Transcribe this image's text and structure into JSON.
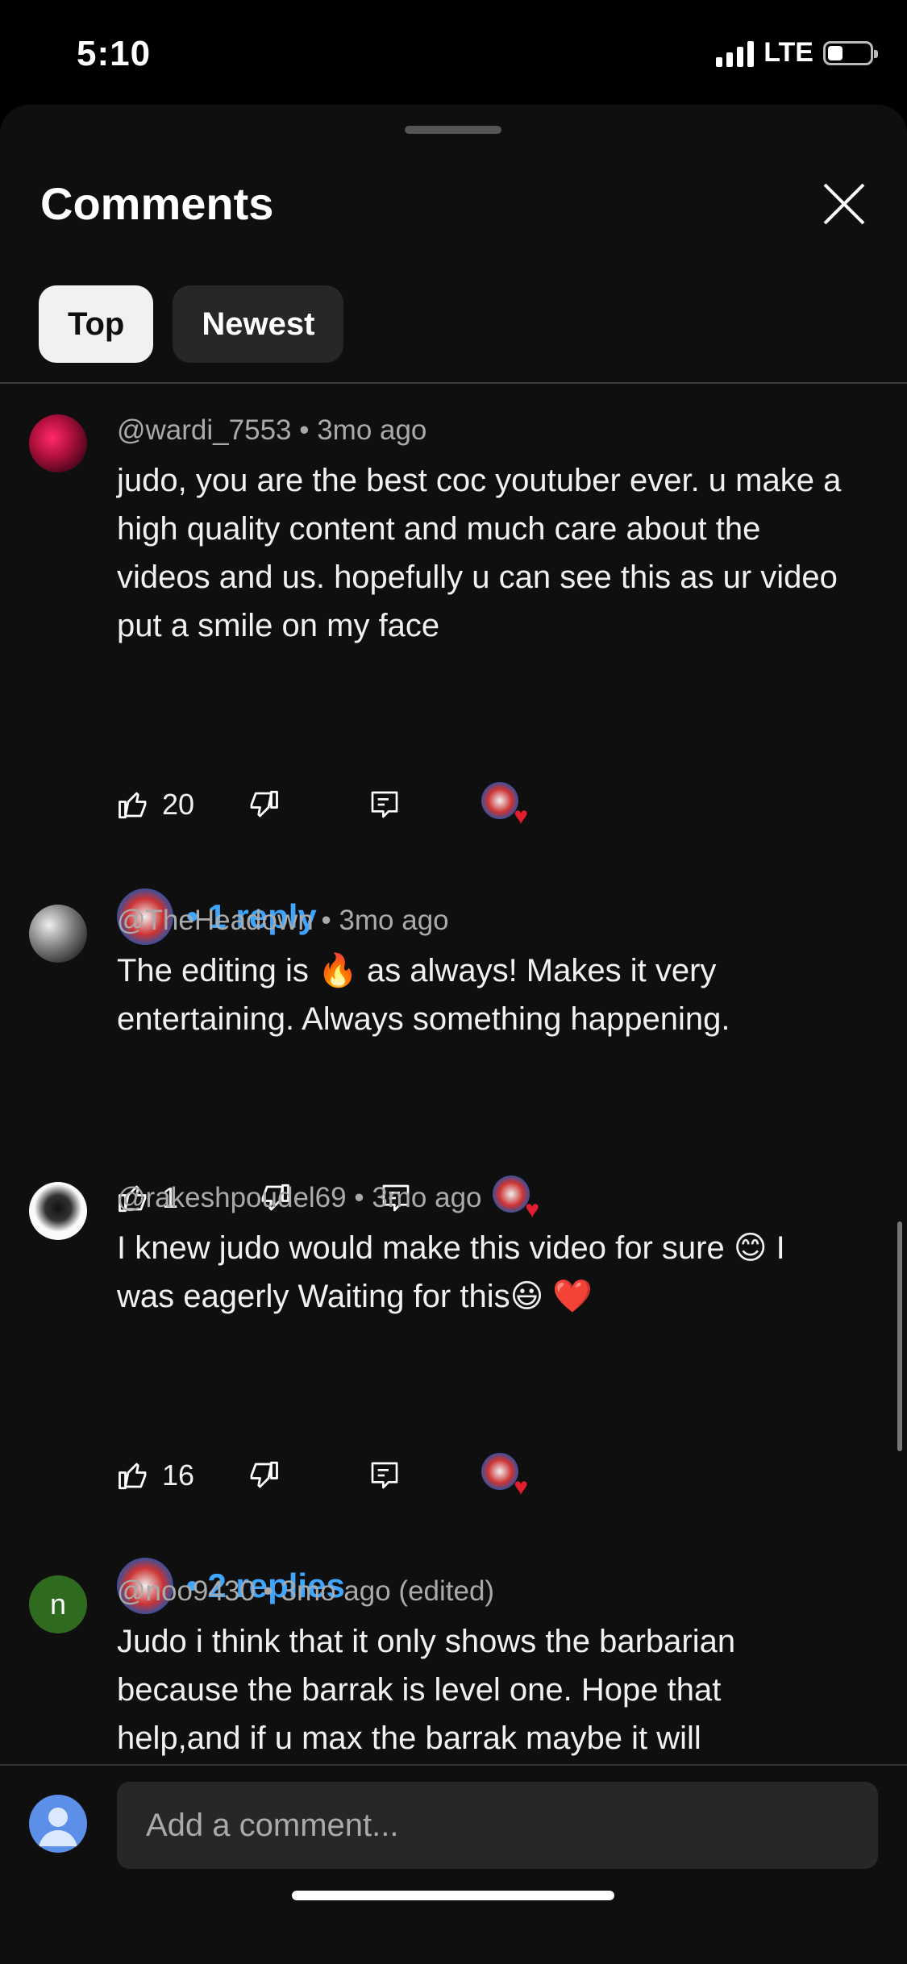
{
  "status": {
    "time": "5:10",
    "network": "LTE"
  },
  "sheet": {
    "title": "Comments",
    "tabs": [
      {
        "label": "Top",
        "active": true
      },
      {
        "label": "Newest",
        "active": false
      }
    ]
  },
  "comments": [
    {
      "meta": "@wardi_7553 • 3mo ago",
      "text": "judo, you are the best coc youtuber ever. u make a high quality content and much care about the videos and us. hopefully u can see this as ur video put a smile on my face",
      "likes": "20",
      "replies_label": "• 1 reply"
    },
    {
      "meta": "@TheHeadown • 3mo ago",
      "text": "The editing is 🔥 as always! Makes it very entertaining. Always something happening.",
      "likes": "1"
    },
    {
      "meta": "@rakeshpoudel69 • 3mo ago",
      "text": "I knew judo would make this video for sure 😊 I was eagerly Waiting for this😃 ❤️",
      "likes": "16",
      "replies_label": "• 2 replies"
    },
    {
      "meta": "@noo9430 • 3mo ago (edited)",
      "avatar_letter": "n",
      "text": "Judo i think that it only shows the barbarian because the barrak is level one. Hope that help,and if u max the barrak maybe it will"
    }
  ],
  "composer": {
    "placeholder": "Add a comment..."
  },
  "colors": {
    "accent": "#3ea6ff",
    "heart": "#e01e2d",
    "background": "#0f0f0f"
  }
}
